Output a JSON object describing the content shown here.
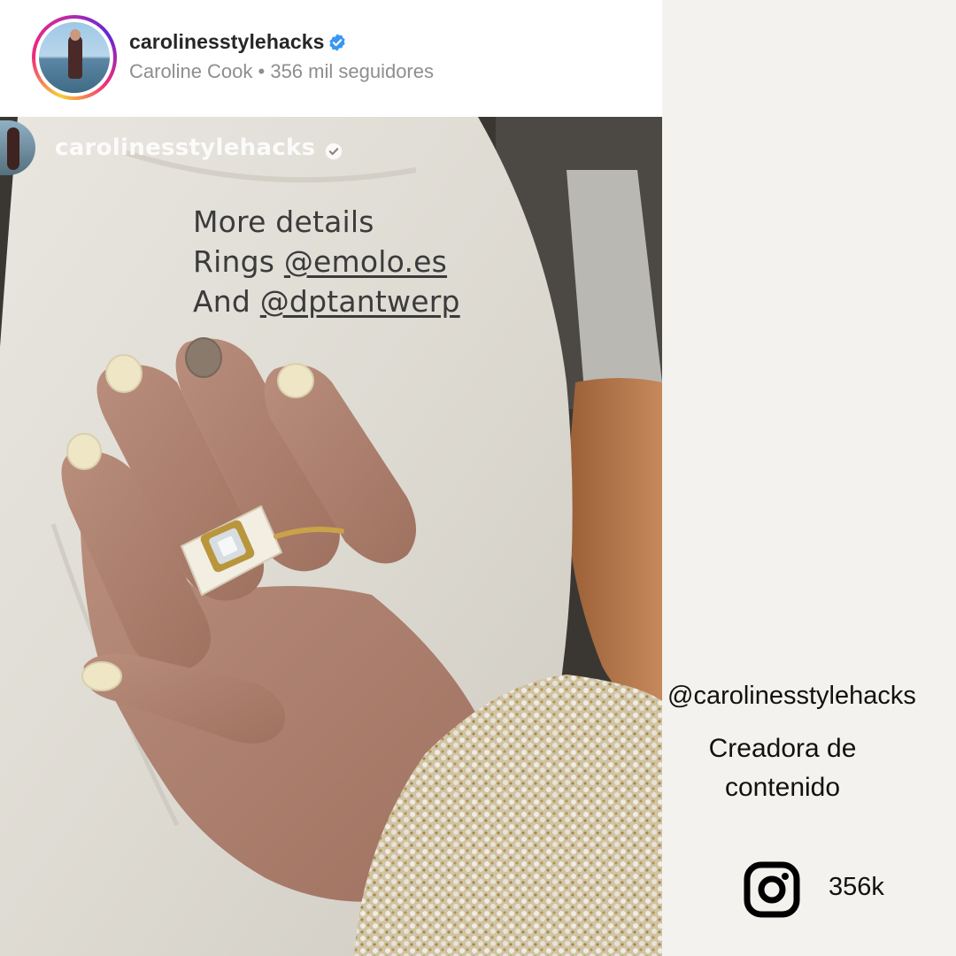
{
  "header": {
    "username": "carolinesstylehacks",
    "subline": "Caroline Cook • 356 mil seguidores"
  },
  "story": {
    "username": "carolinesstylehacks",
    "line1": "More details",
    "line2_prefix": "Rings ",
    "line2_mention": "@emolo.es",
    "line3_prefix": "And ",
    "line3_mention": "@dptantwerp"
  },
  "profile": {
    "handle": "@carolinesstylehacks",
    "role": "Creadora de contenido",
    "followers": "356k"
  },
  "colors": {
    "verified": "#3897f0",
    "ring_gradient": [
      "#f9ce34",
      "#ee2a7b",
      "#6228d7"
    ]
  },
  "icons": [
    "verified-icon",
    "instagram-icon"
  ]
}
